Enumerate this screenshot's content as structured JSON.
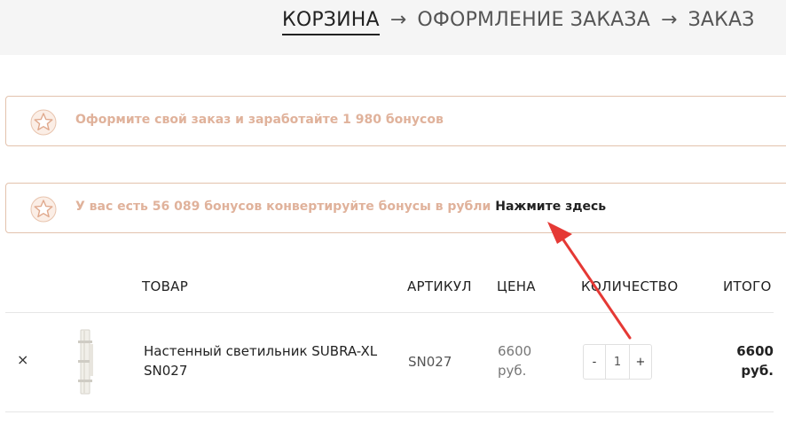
{
  "steps": [
    {
      "label": "КОРЗИНА",
      "active": true
    },
    {
      "label": "ОФОРМЛЕНИЕ ЗАКАЗА",
      "active": false
    },
    {
      "label": "ЗАКАЗ",
      "active": false
    }
  ],
  "step_separator": "→",
  "notices": {
    "earn": {
      "text": "Оформите свой заказ и заработайте 1 980 бонусов",
      "icon": "star-icon"
    },
    "convert": {
      "text": "У вас есть 56 089 бонусов конвертируйте бонусы в рубли",
      "link": "Нажмите здесь",
      "icon": "star-icon"
    }
  },
  "table": {
    "headers": {
      "product": "ТОВАР",
      "sku": "АРТИКУЛ",
      "price": "ЦЕНА",
      "quantity": "КОЛИЧЕСТВО",
      "total": "ИТОГО"
    },
    "rows": [
      {
        "remove": "×",
        "name": "Настенный светильник SUBRA-XL SN027",
        "sku": "SN027",
        "price": "6600 руб.",
        "qty_minus": "-",
        "qty": "1",
        "qty_plus": "+",
        "total": "6600 руб."
      }
    ]
  },
  "colors": {
    "accent": "#e0b29b",
    "border": "#e3c2ad",
    "annotation_arrow": "#e53935"
  }
}
